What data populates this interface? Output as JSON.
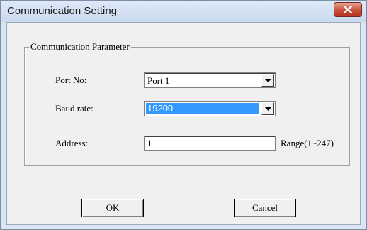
{
  "window": {
    "title": "Communication Setting"
  },
  "group": {
    "label": "Communication Parameter"
  },
  "port": {
    "label": "Port No:",
    "value": "Port 1"
  },
  "baud": {
    "label": "Baud rate:",
    "value": "19200"
  },
  "address": {
    "label": "Address:",
    "value": "1",
    "range": "Range(1~247)"
  },
  "buttons": {
    "ok": "OK",
    "cancel": "Cancel"
  },
  "icons": {
    "close": "close-icon",
    "dropdown": "chevron-down-icon"
  },
  "colors": {
    "selection": "#3399ff",
    "close_button": "#c8503a"
  }
}
